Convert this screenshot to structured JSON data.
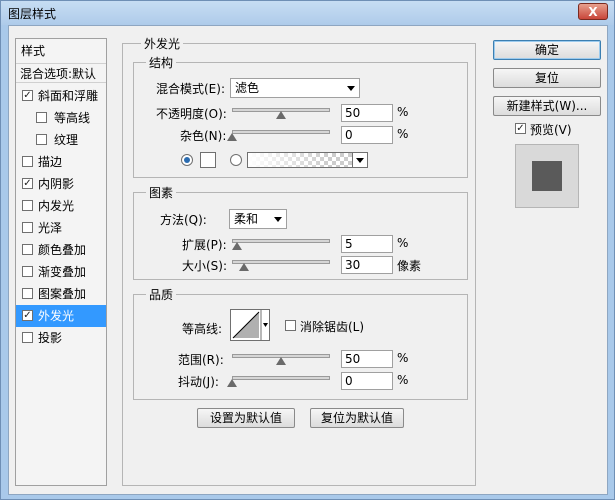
{
  "window": {
    "title": "图层样式",
    "close_glyph": "X"
  },
  "style_list": {
    "header": "样式",
    "blend_options": "混合选项:默认",
    "items": [
      {
        "label": "斜面和浮雕",
        "checked": true,
        "indent": false
      },
      {
        "label": "等高线",
        "checked": false,
        "indent": true
      },
      {
        "label": "纹理",
        "checked": false,
        "indent": true
      },
      {
        "label": "描边",
        "checked": false,
        "indent": false
      },
      {
        "label": "内阴影",
        "checked": true,
        "indent": false
      },
      {
        "label": "内发光",
        "checked": false,
        "indent": false
      },
      {
        "label": "光泽",
        "checked": false,
        "indent": false
      },
      {
        "label": "颜色叠加",
        "checked": false,
        "indent": false
      },
      {
        "label": "渐变叠加",
        "checked": false,
        "indent": false
      },
      {
        "label": "图案叠加",
        "checked": false,
        "indent": false
      },
      {
        "label": "外发光",
        "checked": true,
        "indent": false,
        "selected": true
      },
      {
        "label": "投影",
        "checked": false,
        "indent": false
      }
    ]
  },
  "panel": {
    "title": "外发光",
    "structure": {
      "title": "结构",
      "blend_mode_label": "混合模式(E):",
      "blend_mode_value": "滤色",
      "opacity_label": "不透明度(O):",
      "opacity_value": "50",
      "opacity_fraction": 0.5,
      "noise_label": "杂色(N):",
      "noise_value": "0",
      "noise_fraction": 0.0,
      "unit": "%"
    },
    "elements": {
      "title": "图素",
      "technique_label": "方法(Q):",
      "technique_value": "柔和",
      "spread_label": "扩展(P):",
      "spread_value": "5",
      "spread_fraction": 0.05,
      "size_label": "大小(S):",
      "size_value": "30",
      "size_fraction": 0.12,
      "percent_unit": "%",
      "px_unit": "像素"
    },
    "quality": {
      "title": "品质",
      "contour_label": "等高线:",
      "antialias_label": "消除锯齿(L)",
      "antialias_checked": false,
      "range_label": "范围(R):",
      "range_value": "50",
      "range_fraction": 0.5,
      "jitter_label": "抖动(J):",
      "jitter_value": "0",
      "jitter_fraction": 0.0,
      "unit": "%"
    },
    "make_default": "设置为默认值",
    "reset_default": "复位为默认值"
  },
  "right": {
    "ok": "确定",
    "reset": "复位",
    "new_style": "新建样式(W)...",
    "preview_label": "预览(V)",
    "preview_checked": true
  },
  "colors": {
    "selection": "#3399ff",
    "swatch": "#ffffff",
    "preview_fill": "#5a5a5a"
  }
}
